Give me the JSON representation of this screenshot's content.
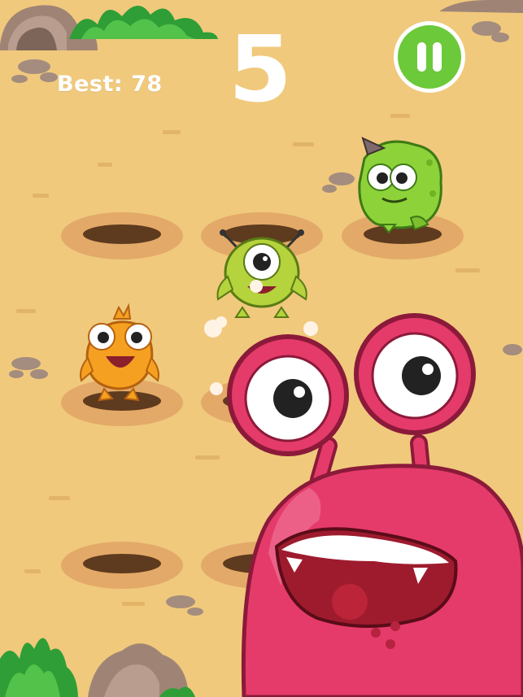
{
  "hud": {
    "best_label": "Best: 78",
    "score": "5",
    "pause_icon": "pause-icon"
  },
  "colors": {
    "ground": "#F0C97C",
    "hole_rim": "#E3A968",
    "hole_inner": "#5E3A1E",
    "pause_green": "#6CC93A",
    "rock": "#9F8476",
    "grass": "#3DB340"
  },
  "holes": {
    "rows": 3,
    "columns": 3
  },
  "monsters": [
    {
      "name": "green-horned-monster",
      "color": "#8ED23A"
    },
    {
      "name": "green-cyclops-monster",
      "color": "#B4D33C"
    },
    {
      "name": "orange-monster",
      "color": "#F5A020"
    },
    {
      "name": "pink-snail-monster",
      "color": "#E53B6A"
    }
  ]
}
